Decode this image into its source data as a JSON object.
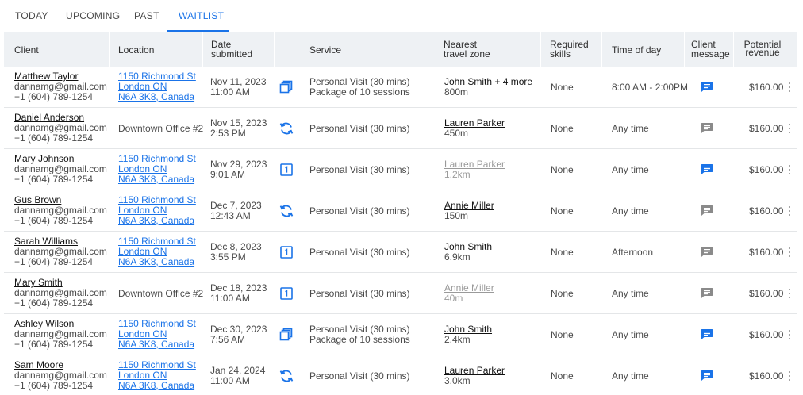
{
  "tabs": [
    {
      "label": "TODAY",
      "active": false
    },
    {
      "label": "UPCOMING",
      "active": false
    },
    {
      "label": "PAST",
      "active": false
    },
    {
      "label": "WAITLIST",
      "active": true
    }
  ],
  "colors": {
    "accent": "#1a73e8",
    "header_bg": "#eef1f4",
    "message_active": "#1a73e8",
    "message_inactive": "#8a8a8a",
    "muted_text": "#9a9a9a"
  },
  "columns": {
    "client": "Client",
    "location": "Location",
    "date_1": "Date",
    "date_2": "submitted",
    "service": "Service",
    "zone_1": "Nearest",
    "zone_2": "travel zone",
    "skills_1": "Required",
    "skills_2": "skills",
    "time": "Time of day",
    "message_1": "Client",
    "message_2": "message",
    "revenue_1": "Potential",
    "revenue_2": "revenue"
  },
  "rows": [
    {
      "client_name": "Matthew Taylor",
      "client_name_linked": true,
      "email": "dannamg@gmail.com",
      "phone": "+1 (604) 789-1254",
      "location_linked": true,
      "loc1": "1150 Richmond St",
      "loc2": "London ON",
      "loc3": "N6A 3K8, Canada",
      "date": "Nov 11, 2023",
      "time": "11:00 AM",
      "service_icon": "package-icon",
      "service1": "Personal Visit (30 mins)",
      "service2": "Package of 10 sessions",
      "zone_name": "John Smith + 4 more",
      "zone_dist": "800m",
      "zone_muted": false,
      "skills": "None",
      "time_of_day": "8:00 AM - 2:00PM",
      "message_active": true,
      "revenue": "$160.00"
    },
    {
      "client_name": "Daniel Anderson",
      "client_name_linked": true,
      "email": "dannamg@gmail.com",
      "phone": "+1 (604) 789-1254",
      "location_linked": false,
      "loc1": "Downtown Office #2",
      "loc2": "",
      "loc3": "",
      "date": "Nov 15, 2023",
      "time": "2:53 PM",
      "service_icon": "recurring-icon",
      "service1": "Personal Visit (30 mins)",
      "service2": "",
      "zone_name": "Lauren Parker",
      "zone_dist": "450m",
      "zone_muted": false,
      "skills": "None",
      "time_of_day": "Any time",
      "message_active": false,
      "revenue": "$160.00"
    },
    {
      "client_name": "Mary Johnson",
      "client_name_linked": false,
      "email": "dannamg@gmail.com",
      "phone": "+1 (604) 789-1254",
      "location_linked": true,
      "loc1": "1150 Richmond St",
      "loc2": "London ON",
      "loc3": "N6A 3K8, Canada",
      "date": "Nov 29, 2023",
      "time": "9:01 AM",
      "service_icon": "single-session-icon",
      "service1": "Personal Visit (30 mins)",
      "service2": "",
      "zone_name": "Lauren Parker",
      "zone_dist": "1.2km",
      "zone_muted": true,
      "skills": "None",
      "time_of_day": "Any time",
      "message_active": true,
      "revenue": "$160.00"
    },
    {
      "client_name": "Gus Brown",
      "client_name_linked": true,
      "email": "dannamg@gmail.com",
      "phone": "+1 (604) 789-1254",
      "location_linked": true,
      "loc1": "1150 Richmond St",
      "loc2": "London ON",
      "loc3": "N6A 3K8, Canada",
      "date": "Dec 7, 2023",
      "time": "12:43 AM",
      "service_icon": "recurring-icon",
      "service1": "Personal Visit (30 mins)",
      "service2": "",
      "zone_name": "Annie Miller",
      "zone_dist": "150m",
      "zone_muted": false,
      "skills": "None",
      "time_of_day": "Any time",
      "message_active": false,
      "revenue": "$160.00"
    },
    {
      "client_name": "Sarah Williams",
      "client_name_linked": true,
      "email": "dannamg@gmail.com",
      "phone": "+1 (604) 789-1254",
      "location_linked": true,
      "loc1": "1150 Richmond St",
      "loc2": "London ON",
      "loc3": "N6A 3K8, Canada",
      "date": "Dec 8, 2023",
      "time": "3:55 PM",
      "service_icon": "single-session-icon",
      "service1": "Personal Visit (30 mins)",
      "service2": "",
      "zone_name": "John Smith",
      "zone_dist": "6.9km",
      "zone_muted": false,
      "skills": "None",
      "time_of_day": "Afternoon",
      "message_active": false,
      "revenue": "$160.00"
    },
    {
      "client_name": "Mary Smith",
      "client_name_linked": true,
      "email": "dannamg@gmail.com",
      "phone": "+1 (604) 789-1254",
      "location_linked": false,
      "loc1": "Downtown Office #2",
      "loc2": "",
      "loc3": "",
      "date": "Dec 18, 2023",
      "time": "11:00 AM",
      "service_icon": "single-session-icon",
      "service1": "Personal Visit (30 mins)",
      "service2": "",
      "zone_name": "Annie Miller",
      "zone_dist": "40m",
      "zone_muted": true,
      "skills": "None",
      "time_of_day": "Any time",
      "message_active": false,
      "revenue": "$160.00"
    },
    {
      "client_name": "Ashley Wilson",
      "client_name_linked": true,
      "email": "dannamg@gmail.com",
      "phone": "+1 (604) 789-1254",
      "location_linked": true,
      "loc1": "1150 Richmond St",
      "loc2": "London ON",
      "loc3": "N6A 3K8, Canada",
      "date": "Dec 30, 2023",
      "time": "7:56 AM",
      "service_icon": "package-icon",
      "service1": "Personal Visit (30 mins)",
      "service2": "Package of 10 sessions",
      "zone_name": "John Smith",
      "zone_dist": "2.4km",
      "zone_muted": false,
      "skills": "None",
      "time_of_day": "Any time",
      "message_active": true,
      "revenue": "$160.00"
    },
    {
      "client_name": "Sam Moore",
      "client_name_linked": true,
      "email": "dannamg@gmail.com",
      "phone": "+1 (604) 789-1254",
      "location_linked": true,
      "loc1": "1150 Richmond St",
      "loc2": "London ON",
      "loc3": "N6A 3K8, Canada",
      "date": "Jan 24, 2024",
      "time": "11:00 AM",
      "service_icon": "recurring-icon",
      "service1": "Personal Visit (30 mins)",
      "service2": "",
      "zone_name": "Lauren Parker",
      "zone_dist": "3.0km",
      "zone_muted": false,
      "skills": "None",
      "time_of_day": "Any time",
      "message_active": true,
      "revenue": "$160.00"
    }
  ]
}
